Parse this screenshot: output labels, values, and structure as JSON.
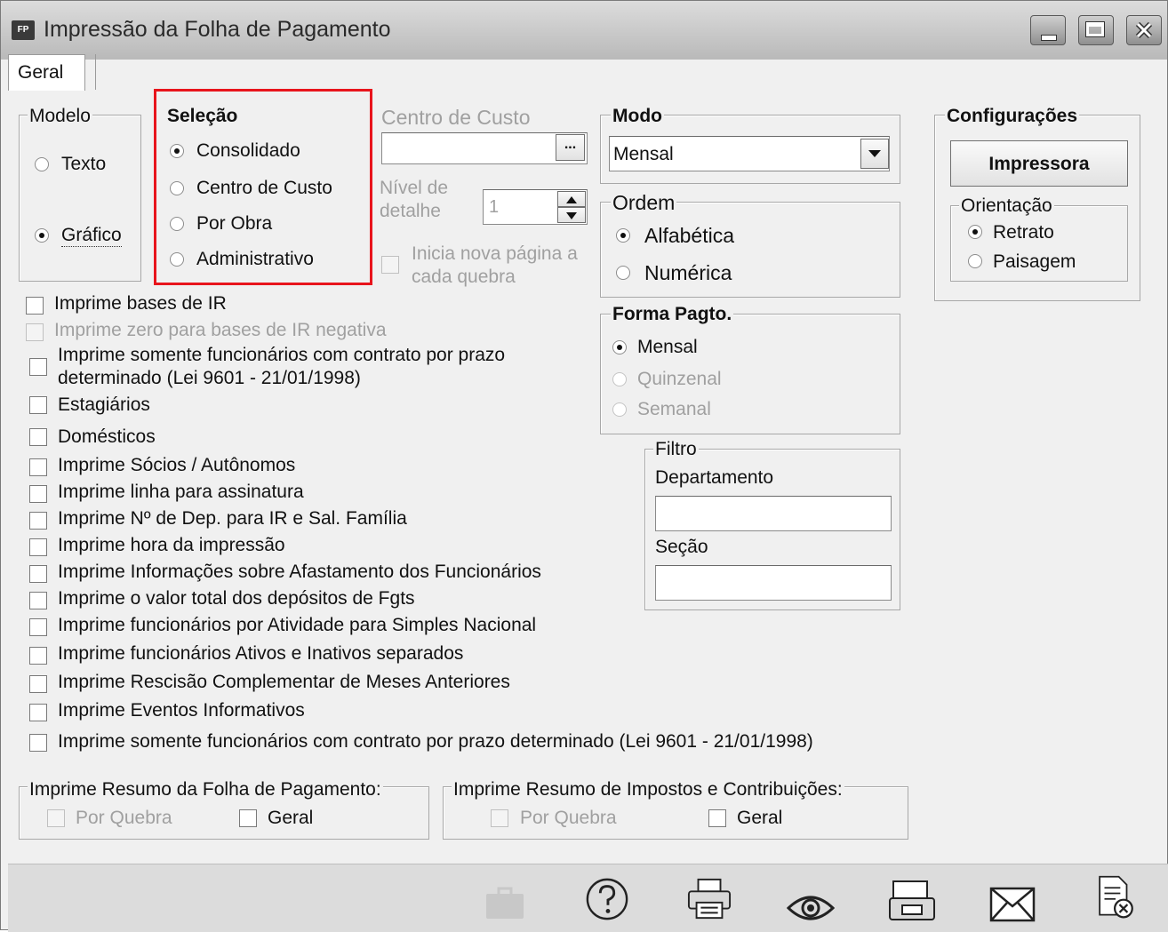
{
  "window": {
    "title": "Impressão da Folha de Pagamento",
    "icon_text": "FP"
  },
  "tabs": [
    {
      "label": "Geral"
    }
  ],
  "modelo": {
    "title": "Modelo",
    "options": [
      "Texto",
      "Gráfico"
    ],
    "selected": "Gráfico"
  },
  "selecao": {
    "title": "Seleção",
    "options": [
      "Consolidado",
      "Centro de Custo",
      "Por Obra",
      "Administrativo"
    ],
    "selected": "Consolidado",
    "highlight_color": "#e8141c"
  },
  "centro_custo": {
    "title": "Centro de Custo",
    "value": "",
    "button_label": "...",
    "nivel_label_1": "Nível de",
    "nivel_label_2": "detalhe",
    "nivel_value": "1",
    "nova_pagina_1": "Inicia nova página a",
    "nova_pagina_2": "cada quebra"
  },
  "modo": {
    "title": "Modo",
    "value": "Mensal"
  },
  "ordem": {
    "title": "Ordem",
    "options": [
      "Alfabética",
      "Numérica"
    ],
    "selected": "Alfabética"
  },
  "forma_pagto": {
    "title": "Forma Pagto.",
    "options": [
      "Mensal",
      "Quinzenal",
      "Semanal"
    ],
    "selected": "Mensal"
  },
  "filtro": {
    "title": "Filtro",
    "departamento_label": "Departamento",
    "departamento_value": "",
    "secao_label": "Seção",
    "secao_value": ""
  },
  "configuracoes": {
    "title": "Configurações",
    "impressora_label": "Impressora",
    "orientacao_title": "Orientação",
    "orientacao_options": [
      "Retrato",
      "Paisagem"
    ],
    "orientacao_selected": "Retrato"
  },
  "checkboxes": [
    {
      "label": "Imprime bases de IR",
      "enabled": true,
      "checked": false
    },
    {
      "label": "Imprime zero para bases de IR negativa",
      "enabled": false,
      "checked": false
    },
    {
      "label": "Imprime somente funcionários com contrato por prazo",
      "label2": "determinado (Lei 9601 - 21/01/1998)",
      "enabled": true,
      "checked": false
    },
    {
      "label": "Estagiários",
      "enabled": true,
      "checked": false
    },
    {
      "label": "Domésticos",
      "enabled": true,
      "checked": false
    },
    {
      "label": "Imprime Sócios / Autônomos",
      "enabled": true,
      "checked": false
    },
    {
      "label": "Imprime linha para assinatura",
      "enabled": true,
      "checked": false
    },
    {
      "label": "Imprime Nº de Dep. para IR e Sal. Família",
      "enabled": true,
      "checked": false
    },
    {
      "label": "Imprime hora da impressão",
      "enabled": true,
      "checked": false
    },
    {
      "label": "Imprime Informações sobre Afastamento dos Funcionários",
      "enabled": true,
      "checked": false
    },
    {
      "label": "Imprime o valor total dos depósitos de Fgts",
      "enabled": true,
      "checked": false
    },
    {
      "label": "Imprime funcionários por Atividade para Simples Nacional",
      "enabled": true,
      "checked": false
    },
    {
      "label": "Imprime funcionários Ativos e Inativos separados",
      "enabled": true,
      "checked": false
    },
    {
      "label": "Imprime Rescisão Complementar de Meses Anteriores",
      "enabled": true,
      "checked": false
    },
    {
      "label": "Imprime Eventos Informativos",
      "enabled": true,
      "checked": false
    },
    {
      "label": "Imprime somente funcionários com contrato por prazo determinado (Lei 9601 - 21/01/1998)",
      "enabled": true,
      "checked": false
    }
  ],
  "resumo_folha": {
    "title": "Imprime Resumo da Folha de Pagamento:",
    "por_quebra": "Por Quebra",
    "geral": "Geral"
  },
  "resumo_impostos": {
    "title": "Imprime Resumo de Impostos e Contribuições:",
    "por_quebra": "Por Quebra",
    "geral": "Geral"
  },
  "footer": {
    "icons": [
      "briefcase-icon",
      "help-icon",
      "printer-icon",
      "preview-eye-icon",
      "print-preview-icon",
      "email-icon",
      "close-document-icon"
    ]
  }
}
